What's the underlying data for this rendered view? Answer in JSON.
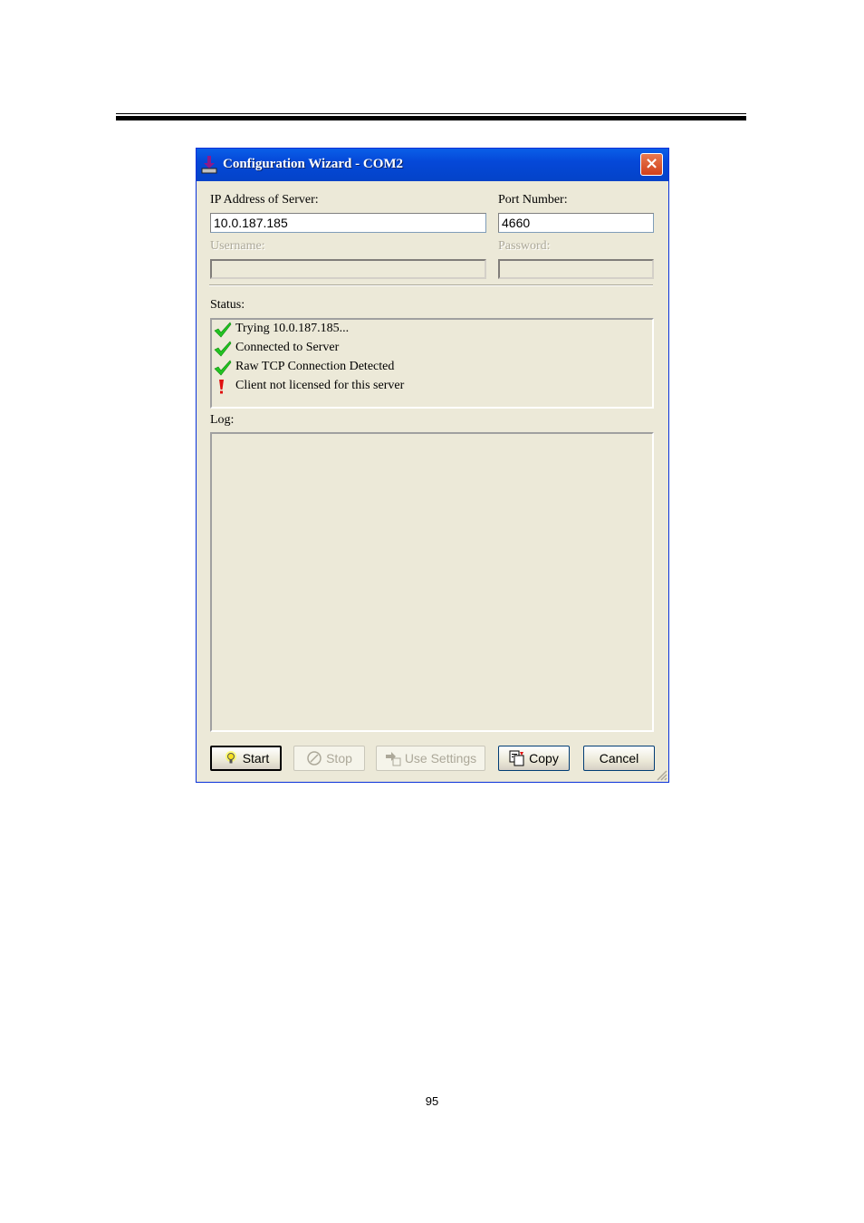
{
  "window": {
    "title": "Configuration Wizard - COM2",
    "close_label": "×",
    "colors": {
      "titlebar": "#0548d8",
      "body": "#ece9d8",
      "close": "#d1401b",
      "check": "#22c322",
      "alert": "#e01010"
    }
  },
  "form": {
    "ip_label": "IP Address of Server:",
    "ip_value": "10.0.187.185",
    "port_label": "Port Number:",
    "port_value": "4660",
    "username_label": "Username:",
    "username_value": "",
    "password_label": "Password:",
    "password_value": ""
  },
  "status": {
    "label": "Status:",
    "items": [
      {
        "icon": "check-icon",
        "text": "Trying 10.0.187.185..."
      },
      {
        "icon": "check-icon",
        "text": "Connected to Server"
      },
      {
        "icon": "check-icon",
        "text": "Raw TCP Connection Detected"
      },
      {
        "icon": "exclamation-icon",
        "text": "Client not licensed for this server"
      }
    ]
  },
  "log": {
    "label": "Log:",
    "content": ""
  },
  "buttons": {
    "start": "Start",
    "stop": "Stop",
    "use_settings": "Use Settings",
    "copy": "Copy",
    "cancel": "Cancel"
  },
  "page": {
    "number": "95"
  }
}
